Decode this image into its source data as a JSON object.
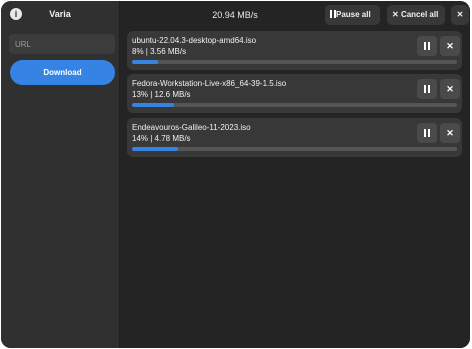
{
  "app": {
    "title": "Varia",
    "info_icon": "i"
  },
  "sidebar": {
    "url_placeholder": "URL",
    "download_label": "Download"
  },
  "header": {
    "total_speed": "20.94 MB/s",
    "pause_all_label": "Pause all",
    "cancel_all_label": "Cancel all",
    "close_glyph": "✕",
    "cancel_glyph": "✕"
  },
  "downloads": [
    {
      "name": "ubuntu-22.04.3-desktop-amd64.iso",
      "status": "8%  |  3.56 MB/s",
      "progress": 0.08
    },
    {
      "name": "Fedora-Workstation-Live-x86_64-39-1.5.iso",
      "status": "13%  |  12.6 MB/s",
      "progress": 0.13
    },
    {
      "name": "Endeavouros-Galileo-11-2023.iso",
      "status": "14%  |  4.78 MB/s",
      "progress": 0.14
    }
  ],
  "colors": {
    "accent": "#3584e4",
    "window_bg": "#242424",
    "sidebar_bg": "#303030",
    "card_bg": "#383838"
  }
}
